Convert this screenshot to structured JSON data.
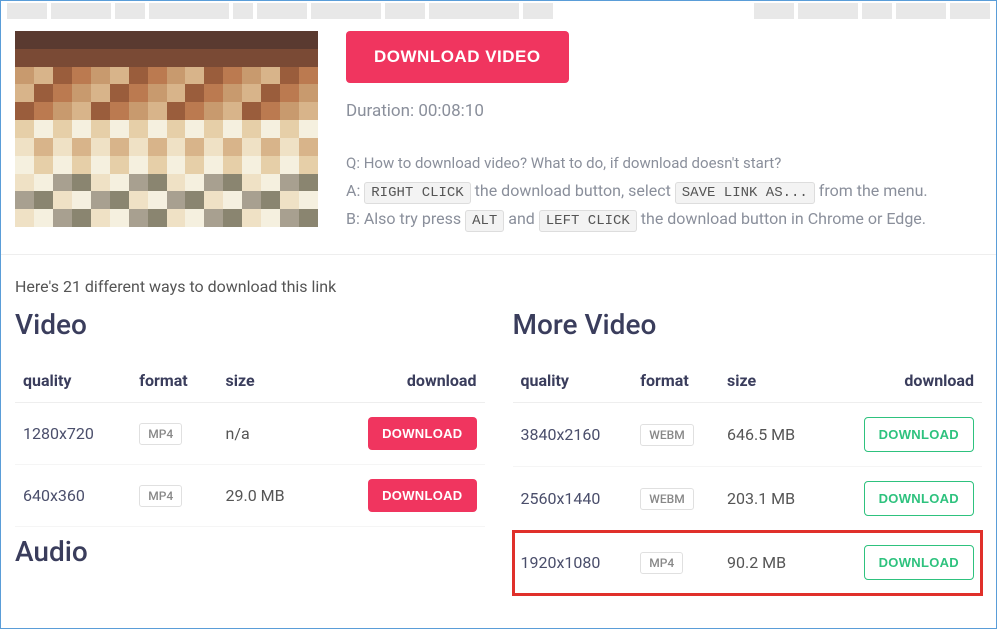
{
  "main_button": "DOWNLOAD VIDEO",
  "duration_label": "Duration: 00:08:10",
  "faq": {
    "q_prefix": "Q: ",
    "q_text": "How to download video? What to do, if download doesn't start?",
    "a_prefix": "A: ",
    "a_kbd1": "RIGHT CLICK",
    "a_mid1": " the download button, select ",
    "a_kbd2": "SAVE LINK AS...",
    "a_suffix1": " from the menu.",
    "b_prefix": "B: Also try press ",
    "b_kbd1": "ALT",
    "b_mid": " and ",
    "b_kbd2": "LEFT CLICK",
    "b_suffix": " the download button in Chrome or Edge."
  },
  "summary": "Here's 21 different ways to download this link",
  "heading_video": "Video",
  "heading_more_video": "More Video",
  "heading_audio": "Audio",
  "columns": {
    "quality": "quality",
    "format": "format",
    "size": "size",
    "download": "download"
  },
  "dl_label": "DOWNLOAD",
  "video_rows": [
    {
      "quality": "1280x720",
      "format": "MP4",
      "size": "n/a"
    },
    {
      "quality": "640x360",
      "format": "MP4",
      "size": "29.0 MB"
    }
  ],
  "more_video_rows": [
    {
      "quality": "3840x2160",
      "format": "WEBM",
      "size": "646.5 MB",
      "highlighted": false
    },
    {
      "quality": "2560x1440",
      "format": "WEBM",
      "size": "203.1 MB",
      "highlighted": false
    },
    {
      "quality": "1920x1080",
      "format": "MP4",
      "size": "90.2 MB",
      "highlighted": true
    }
  ]
}
